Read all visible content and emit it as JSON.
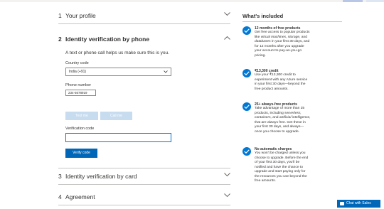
{
  "steps": [
    {
      "num": "1",
      "name": "Your profile"
    },
    {
      "num": "2",
      "name": "Identity verification by phone"
    },
    {
      "num": "3",
      "name": "Identity verification by card"
    },
    {
      "num": "4",
      "name": "Agreement"
    }
  ],
  "identity": {
    "description": "A text or phone call helps us make sure this is you.",
    "country_label": "Country code",
    "country_value": "India (+91)",
    "phone_label": "Phone number",
    "phone_value": "234-5678919",
    "text_me": "Text me",
    "call_me": "Call me",
    "code_label": "Verification code",
    "code_value": "",
    "verify": "Verify code"
  },
  "included": {
    "title": "What's included",
    "benefits": [
      {
        "title": "12 months of free products",
        "b1": "Get free access to popular products",
        "b2a": "like ",
        "b2i": "virtual machines, storage,",
        "b2b": " and",
        "b3i": "databases",
        "b3b": " in your first 30 days, and",
        "b4": "for 12 months after you upgrade",
        "b5": "your account to pay-as-you-go",
        "b6": "pricing."
      },
      {
        "title": "₹13,300 credit",
        "b1": "Use your ₹13,300 credit to",
        "b2": "experiment with any Azure service",
        "b3": "in your first 30 days—beyond the",
        "b4": "free product amounts."
      },
      {
        "title": "25+ always-free products",
        "b1": "Take advantage of more than 25",
        "b2a": "products, including ",
        "b2i": "serverless,",
        "b3i": "containers,",
        "b3b": " and ",
        "b3i2": "artificial intelligence,",
        "b4": "that are always free. Get these in",
        "b5": "your first 30 days, and always—",
        "b6": "once you choose to upgrade."
      },
      {
        "title": "No automatic charges",
        "b1": "You won't be charged unless you",
        "b2": "choose to upgrade. Before the end",
        "b3": "of your first 30 days, you'll be",
        "b4": "notified and have the chance to",
        "b5": "upgrade and start paying only for",
        "b6": "the resources you use beyond the",
        "b7": "free amounts."
      }
    ]
  },
  "chat": {
    "label": "Chat with Sales"
  },
  "icons": {
    "collapsed": "chevron-down-icon",
    "expanded": "chevron-up-icon",
    "check": "checkmark-circle-icon",
    "chat": "chat-icon"
  },
  "colors": {
    "accent": "#0078d4",
    "button": "#0067b8",
    "disabled_button": "#c7dcef"
  }
}
